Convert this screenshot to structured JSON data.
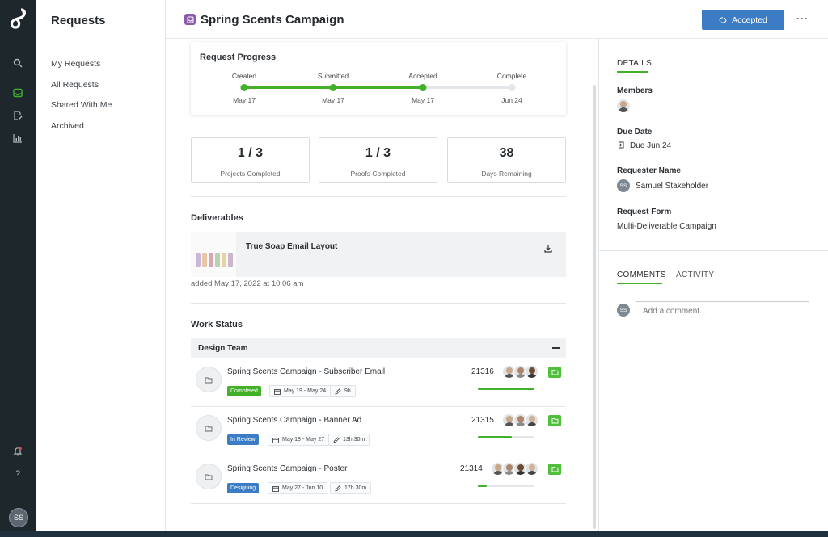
{
  "nav": {
    "title": "Requests",
    "items": [
      "My Requests",
      "All Requests",
      "Shared With Me",
      "Archived"
    ]
  },
  "rail": {
    "icons": [
      "search-icon",
      "inbox-icon",
      "edit-icon",
      "reports-icon",
      "notification-icon",
      "help-icon"
    ],
    "active": "inbox-icon",
    "user_initials": "SS"
  },
  "header": {
    "title": "Spring Scents Campaign",
    "status_button": "Accepted",
    "more": "···"
  },
  "progress": {
    "title": "Request Progress",
    "steps": [
      {
        "label": "Created",
        "date": "May 17",
        "done": true
      },
      {
        "label": "Submitted",
        "date": "May 17",
        "done": true
      },
      {
        "label": "Accepted",
        "date": "May 17",
        "done": true
      },
      {
        "label": "Complete",
        "date": "Jun 24",
        "done": false
      }
    ]
  },
  "stats": [
    {
      "value": "1 / 3",
      "label": "Projects Completed"
    },
    {
      "value": "1 / 3",
      "label": "Proofs Completed"
    },
    {
      "value": "38",
      "label": "Days Remaining"
    }
  ],
  "deliverables": {
    "title": "Deliverables",
    "items": [
      {
        "name": "True Soap Email Layout",
        "added": "added May 17, 2022 at 10:06 am"
      }
    ]
  },
  "work_status": {
    "title": "Work Status",
    "team": "Design Team",
    "rows": [
      {
        "title": "Spring Scents Campaign - Subscriber Email",
        "status": "Completed",
        "status_color": "#43b02a",
        "dates": "May 19 - May 24",
        "hours": "9h",
        "id": "21316",
        "progress": 1.0,
        "assignees": 3
      },
      {
        "title": "Spring Scents Campaign - Banner Ad",
        "status": "In Review",
        "status_color": "#3b7cc4",
        "dates": "May 18 - May 27",
        "hours": "13h 30m",
        "id": "21315",
        "progress": 0.6,
        "assignees": 3
      },
      {
        "title": "Spring Scents Campaign - Poster",
        "status": "Designing",
        "status_color": "#3b7cc4",
        "dates": "May 27 - Jun 10",
        "hours": "17h 30m",
        "id": "21314",
        "progress": 0.15,
        "assignees": 4
      }
    ]
  },
  "details": {
    "tab": "DETAILS",
    "members_label": "Members",
    "due_label": "Due Date",
    "due_value": "Due Jun 24",
    "requester_label": "Requester Name",
    "requester_initials": "SS",
    "requester_value": "Samuel Stakeholder",
    "form_label": "Request Form",
    "form_value": "Multi-Deliverable Campaign"
  },
  "comments": {
    "tab_comments": "COMMENTS",
    "tab_activity": "ACTIVITY",
    "user_initials": "SS",
    "placeholder": "Add a comment..."
  },
  "colors": {
    "accent_green": "#43b02a",
    "primary_blue": "#3b7cc4",
    "rail_bg": "#1e272c",
    "campaign_purple": "#8a5ba6"
  }
}
